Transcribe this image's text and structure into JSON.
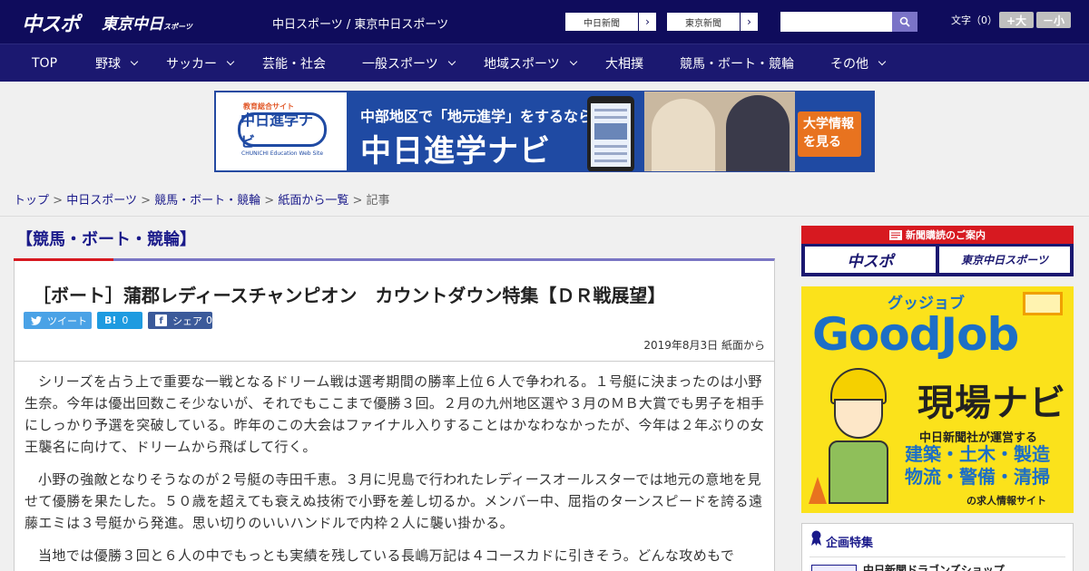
{
  "header": {
    "logo_main": "中スポ",
    "logo_tokyo": "東京中日",
    "logo_tokyo_small": "スポーツ",
    "site_names": "中日スポーツ / 東京中日スポーツ",
    "btn_chunichi": "中日新聞",
    "btn_tokyo": "東京新聞",
    "arrow": "›",
    "search_placeholder": "",
    "font_label": "文字（0）",
    "font_larger": "+大",
    "font_smaller": "－小"
  },
  "nav": {
    "items": [
      "TOP",
      "野球",
      "サッカー",
      "芸能・社会",
      "一般スポーツ",
      "地域スポーツ",
      "大相撲",
      "競馬・ボート・競輪",
      "その他"
    ]
  },
  "banner": {
    "logo_top": "教育総合サイト",
    "logo_main": "中日進学ナビ",
    "logo_sub": "CHUNICHI Education Web Site",
    "tagline": "中部地区で「地元進学」をするなら",
    "title": "中日進学ナビ",
    "cta": "大学情報を見る"
  },
  "breadcrumb": {
    "items": [
      "トップ",
      "中日スポーツ",
      "競馬・ボート・競輪",
      "紙面から一覧"
    ],
    "current": "記事",
    "separator": ">"
  },
  "section_title": "【競馬・ボート・競輪】",
  "article": {
    "title": "［ボート］蒲郡レディースチャンピオン　カウントダウン特集【ＤＲ戦展望】",
    "share_tweet": "ツイート",
    "share_hatena_icon": "B!",
    "share_hatena_count": "0",
    "share_fb_icon": "f",
    "share_fb_label": "シェア",
    "share_fb_count": "0",
    "date": "2019年8月3日 紙面から",
    "paragraphs": [
      "シリーズを占う上で重要な一戦となるドリーム戦は選考期間の勝率上位６人で争われる。１号艇に決まったのは小野生奈。今年は優出回数こそ少ないが、それでもここまで優勝３回。２月の九州地区選や３月のＭＢ大賞でも男子を相手にしっかり予選を突破している。昨年のこの大会はファイナル入りすることはかなわなかったが、今年は２年ぶりの女王襲名に向けて、ドリームから飛ばして行く。",
      "小野の強敵となりそうなのが２号艇の寺田千恵。３月に児島で行われたレディースオールスターでは地元の意地を見せて優勝を果たした。５０歳を超えても衰えぬ技術で小野を差し切るか。メンバー中、屈指のターンスピードを誇る遠藤エミは３号艇から発進。思い切りのいいハンドルで内枠２人に襲い掛かる。",
      "当地では優勝３回と６人の中でもっとも実績を残している長嶋万記は４コースカドに引きそう。どんな攻めもで"
    ]
  },
  "sidebar": {
    "subscribe_title": "新聞購読のご案内",
    "subscribe_chusupo": "中スポ",
    "subscribe_tokyo": "東京中日スポーツ",
    "goodjob_small": "グッジョブ",
    "goodjob_big": "GoodJob",
    "goodjob_main": "現場ナビ",
    "goodjob_sub": "中日新聞社が運営する",
    "goodjob_cats_1": "建築・土木・製造",
    "goodjob_cats_2": "物流・警備・清掃",
    "goodjob_foot": "の求人情報サイト",
    "feature_title": "企画特集",
    "feature_item": "中日新聞ドラゴンズショップ"
  },
  "colors": {
    "header_bg": "#0f0c5c",
    "nav_bg": "#1b1870",
    "accent_red": "#d71920",
    "link": "#1a1a8a",
    "goodjob_yellow": "#fbe21b",
    "goodjob_blue": "#1d6fc6"
  }
}
